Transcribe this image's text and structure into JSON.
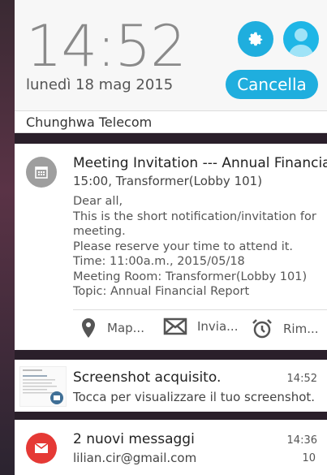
{
  "lockscreen": {
    "time": "14:52",
    "date": "lunedì 18 mag 2015",
    "clear_label": "Cancella",
    "carrier": "Chunghwa Telecom"
  },
  "meeting": {
    "title": "Meeting Invitation --- Annual Financia..",
    "subtitle": "15:00, Transformer(Lobby 101)",
    "body_lines": [
      "Dear all,",
      "This is the short notification/invitation for",
      "meeting.",
      "Please reserve your time to attend it.",
      "Time: 11:00a.m., 2015/05/18",
      "Meeting Room: Transformer(Lobby 101)",
      "Topic: Annual Financial Report"
    ],
    "actions": [
      {
        "label": "Map...",
        "icon": "map-pin-icon"
      },
      {
        "label": "Invia...",
        "icon": "mail-icon"
      },
      {
        "label": "Rim...",
        "icon": "alarm-clock-icon"
      }
    ]
  },
  "screenshot": {
    "title": "Screenshot acquisito.",
    "text": "Tocca per visualizzare il tuo screenshot.",
    "time": "14:52"
  },
  "messages": {
    "title": "2 nuovi messaggi",
    "text": "lilian.cir@gmail.com",
    "time": "14:36",
    "count": "10"
  },
  "colors": {
    "accent": "#1faede",
    "calendar_icon": "#9e9e9e",
    "mail_icon": "#e53935"
  }
}
